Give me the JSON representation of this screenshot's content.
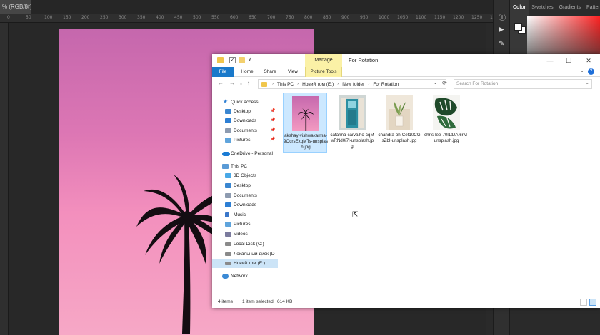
{
  "photoshop": {
    "tab_label": "% (RGB/8*)",
    "tab_close": "×",
    "ruler_ticks": [
      "0",
      "50",
      "100",
      "150",
      "200",
      "250",
      "300",
      "350",
      "400",
      "450",
      "500",
      "550",
      "600",
      "650",
      "700",
      "750",
      "800",
      "850",
      "900",
      "950",
      "1000",
      "1050",
      "1100",
      "1150",
      "1200",
      "1250",
      "1300"
    ],
    "panel_tabs": [
      "Color",
      "Swatches",
      "Gradients",
      "Patterns"
    ],
    "tool_icons": [
      "info-icon",
      "play-icon",
      "brush-settings-icon",
      "gear-icon"
    ]
  },
  "explorer": {
    "manage_tab": "Manage",
    "window_title": "For Rotation",
    "window_controls": {
      "minimize": "—",
      "maximize": "☐",
      "close": "✕"
    },
    "ribbon_tabs": {
      "file": "File",
      "home": "Home",
      "share": "Share",
      "view": "View",
      "picture_tools": "Picture Tools"
    },
    "help": "?",
    "nav": {
      "back": "←",
      "forward": "→",
      "recent": "⌄",
      "up": "↑"
    },
    "address": {
      "crumbs": [
        "This PC",
        "Новий том (E:)",
        "New folder",
        "For Rotation"
      ],
      "separator": "›",
      "dropdown": "⌄",
      "refresh": "⟳"
    },
    "search": {
      "placeholder": "Search For Rotation",
      "icon": "⌕"
    },
    "nav_pane": {
      "quick_access": "Quick access",
      "qa_items": [
        {
          "label": "Desktop",
          "pin": "📌"
        },
        {
          "label": "Downloads",
          "pin": "📌"
        },
        {
          "label": "Documents",
          "pin": "📌"
        },
        {
          "label": "Pictures",
          "pin": "📌"
        }
      ],
      "onedrive": "OneDrive - Personal",
      "this_pc": "This PC",
      "pc_items": [
        "3D Objects",
        "Desktop",
        "Documents",
        "Downloads",
        "Music",
        "Pictures",
        "Videos",
        "Local Disk (C:)",
        "Локальный диск (D",
        "Новий том (E:)"
      ],
      "network": "Network"
    },
    "files": [
      {
        "name": "akshay-vishwakarma-9OcrsExqMTs-unsplash.jpg",
        "selected": true
      },
      {
        "name": "catarina-carvalho-cqMwRNd0i7I-unsplash.jpg",
        "selected": false
      },
      {
        "name": "chandra-oh-Cet10CGsZbI-unsplash.jpg",
        "selected": false
      },
      {
        "name": "chris-lee-70l1tDAI6rM-unsplash.jpg",
        "selected": false
      }
    ],
    "status": {
      "count": "4 items",
      "selected": "1 item selected",
      "size": "614 KB"
    },
    "colors": {
      "file_tab": "#1979ca",
      "manage": "#fbf1a6",
      "selection": "#cce8ff"
    }
  }
}
